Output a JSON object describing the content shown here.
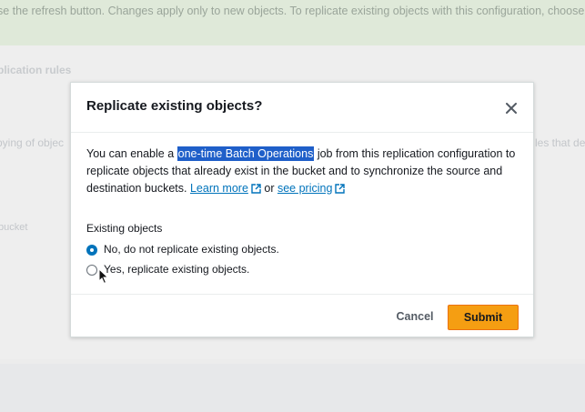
{
  "background": {
    "banner_text": "se the refresh button. Changes apply only to new objects. To replicate existing objects with this configuration, choose C",
    "section_heading": "plication rules",
    "left_text_1": "pying of objec",
    "right_text_1": "les that de",
    "left_text_2": "bucket"
  },
  "modal": {
    "title": "Replicate existing objects?",
    "close_icon": "close-icon",
    "description": {
      "part1": "You can enable a ",
      "highlight": "one-time Batch Operations",
      "part2": " job from this replication configuration to replicate objects that already exist in the bucket and to synchronize the source and destination buckets. ",
      "learn_more": "Learn more",
      "or": " or ",
      "see_pricing": "see pricing"
    },
    "field_label": "Existing objects",
    "options": [
      {
        "label": "No, do not replicate existing objects.",
        "selected": true
      },
      {
        "label": "Yes, replicate existing objects.",
        "selected": false
      }
    ],
    "cancel_label": "Cancel",
    "submit_label": "Submit"
  },
  "colors": {
    "accent": "#0073bb",
    "submit": "#f59e12",
    "highlight": "#1f5fc9"
  }
}
